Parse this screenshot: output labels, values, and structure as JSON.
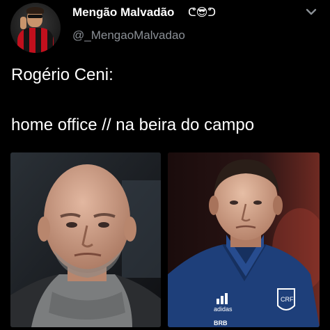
{
  "author": {
    "display_name": "Mengão Malvadão",
    "name_emoji": "ᕦ😎ᕤ",
    "handle": "@_MengaoMalvadao"
  },
  "tweet": {
    "line1": "Rogério Ceni:",
    "line2": "home office // na beira do campo"
  },
  "icons": {
    "more": "chevron-down-icon"
  },
  "media": {
    "left_jacket_text": "",
    "right_logo_text": "adidas",
    "right_crest_text": "CRF",
    "right_sponsor_text": "BRB"
  },
  "colors": {
    "background": "#000000",
    "text": "#ffffff",
    "secondary_text": "#8b9096"
  }
}
